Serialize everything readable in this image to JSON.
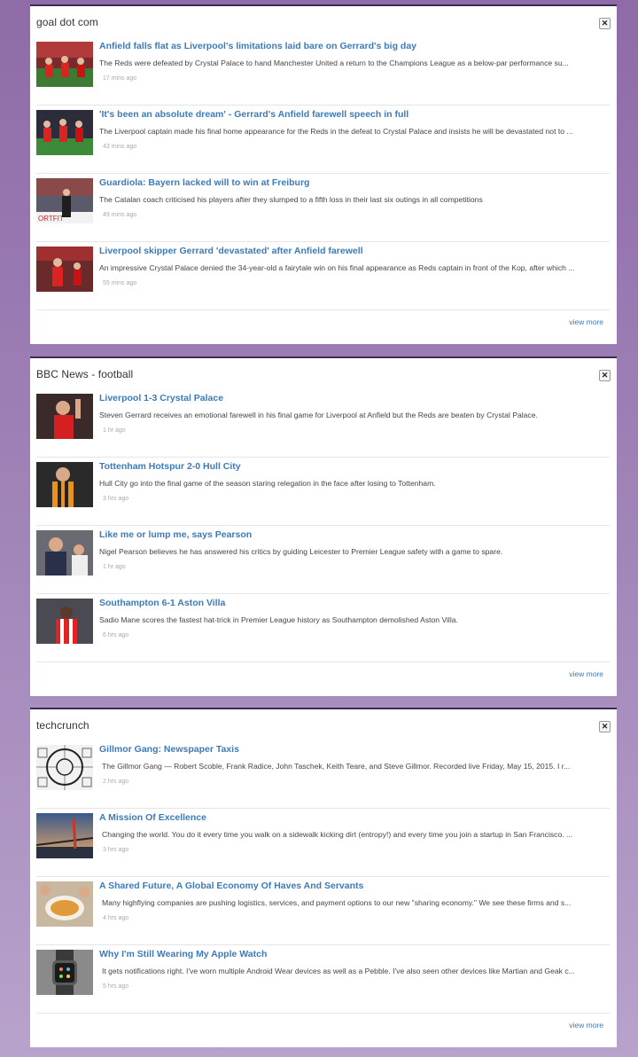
{
  "widgets": [
    {
      "title": "goal dot com",
      "view_more": "view more",
      "items": [
        {
          "headline": "Anfield falls flat as Liverpool's limitations laid bare on Gerrard's big day",
          "desc": "The Reds were defeated by Crystal Palace to hand Manchester United a return to the Champions League as a below-par performance su...",
          "time": "17 mins ago",
          "thumb": "crowd-red"
        },
        {
          "headline": "'It's been an absolute dream' - Gerrard's Anfield farewell speech in full",
          "desc": "The Liverpool captain made his final home appearance for the Reds in the defeat to Crystal Palace and insists he will be devastated not to ...",
          "time": "43 mins ago",
          "thumb": "pitch-players"
        },
        {
          "headline": "Guardiola: Bayern lacked will to win at Freiburg",
          "desc": "The Catalan coach criticised his players after they slumped to a fifth loss in their last six outings in all competitions",
          "time": "49 mins ago",
          "thumb": "coach"
        },
        {
          "headline": "Liverpool skipper Gerrard 'devastated' after Anfield farewell",
          "desc": "An impressive Crystal Palace denied the 34-year-old a fairytale win on his final appearance as Reds captain in front of the Kop, after which ...",
          "time": "55 mins ago",
          "thumb": "crowd-red"
        }
      ]
    },
    {
      "title": "BBC News - football",
      "view_more": "view more",
      "items": [
        {
          "headline": "Liverpool 1-3 Crystal Palace",
          "desc": "Steven Gerrard receives an emotional farewell in his final game for Liverpool at Anfield but the Reds are beaten by Crystal Palace.",
          "time": "1 hr ago",
          "thumb": "player-red"
        },
        {
          "headline": "Tottenham Hotspur 2-0 Hull City",
          "desc": "Hull City go into the final game of the season staring relegation in the face after losing to Tottenham.",
          "time": "3 hrs ago",
          "thumb": "player-amber"
        },
        {
          "headline": "Like me or lump me, says Pearson",
          "desc": "Nigel Pearson believes he has answered his critics by guiding Leicester to Premier League safety with a game to spare.",
          "time": "1 hr ago",
          "thumb": "manager"
        },
        {
          "headline": "Southampton 6-1 Aston Villa",
          "desc": "Sadio Mane scores the fastest hat-trick in Premier League history as Southampton demolished Aston Villa.",
          "time": "6 hrs ago",
          "thumb": "player-stripes"
        }
      ]
    },
    {
      "title": "techcrunch",
      "view_more": "view more",
      "items": [
        {
          "headline": "Gillmor Gang: Newspaper Taxis",
          "desc": "The Gillmor Gang — Robert Scoble, Frank Radice, John Taschek, Keith Teare, and Steve Gillmor. Recorded live Friday, May 15, 2015. I r...",
          "time": "2 hrs ago",
          "thumb": "test-pattern"
        },
        {
          "headline": "A Mission Of Excellence",
          "desc": "Changing the world. You do it every time you walk on a sidewalk kicking dirt (entropy!) and every time you join a startup in San Francisco. ...",
          "time": "3 hrs ago",
          "thumb": "bridge"
        },
        {
          "headline": "A Shared Future, A Global Economy Of Haves And Servants",
          "desc": "Many highflying companies are pushing logistics, services, and payment options to our new \"sharing economy.\" We see these firms and s...",
          "time": "4 hrs ago",
          "thumb": "food"
        },
        {
          "headline": "Why I'm Still Wearing My Apple Watch",
          "desc": "It gets notifications right. I've worn multiple Android Wear devices as well as a Pebble. I've also seen other devices like Martian and Geak c...",
          "time": "5 hrs ago",
          "thumb": "watch"
        }
      ]
    }
  ]
}
